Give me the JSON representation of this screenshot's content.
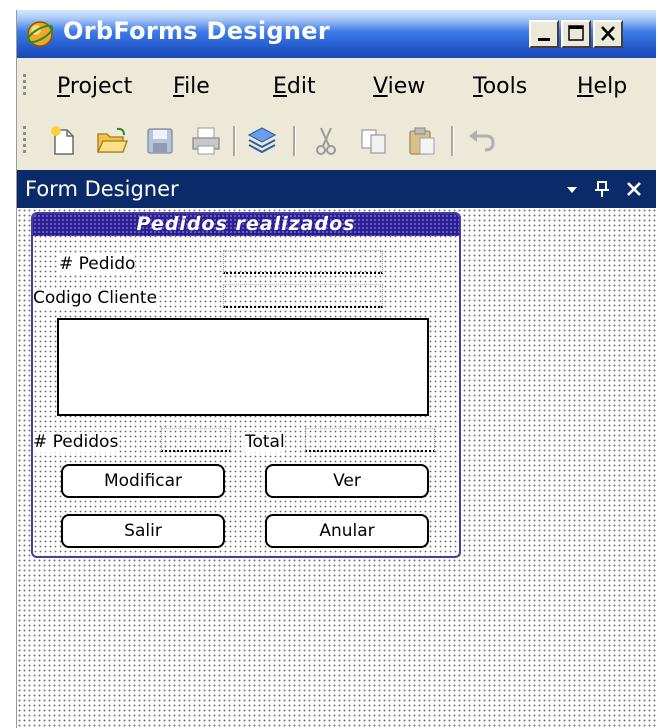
{
  "window": {
    "title": "OrbForms Designer"
  },
  "menu": [
    {
      "label_u": "P",
      "label_rest": "roject"
    },
    {
      "label_u": "F",
      "label_rest": "ile"
    },
    {
      "label_u": "E",
      "label_rest": "dit"
    },
    {
      "label_u": "V",
      "label_rest": "iew"
    },
    {
      "label_u": "T",
      "label_rest": "ools"
    },
    {
      "label_u": "H",
      "label_rest": "elp"
    }
  ],
  "toolbar": {
    "icons": [
      "new-file-icon",
      "open-folder-icon",
      "save-icon",
      "print-icon",
      "layers-icon",
      "cut-icon",
      "copy-icon",
      "paste-icon",
      "undo-icon"
    ]
  },
  "panel": {
    "title": "Form Designer"
  },
  "form": {
    "title": "Pedidos realizados",
    "pedido_label": "# Pedido",
    "cliente_label": "Codigo Cliente",
    "pedidos_label": "# Pedidos",
    "total_label": "Total",
    "buttons": {
      "modificar": "Modificar",
      "ver": "Ver",
      "salir": "Salir",
      "anular": "Anular"
    }
  },
  "colors": {
    "title_bar": "#2357c9",
    "panel_header": "#0a2a6a",
    "form_title": "#2c1f8f",
    "chrome": "#ece9d8"
  }
}
